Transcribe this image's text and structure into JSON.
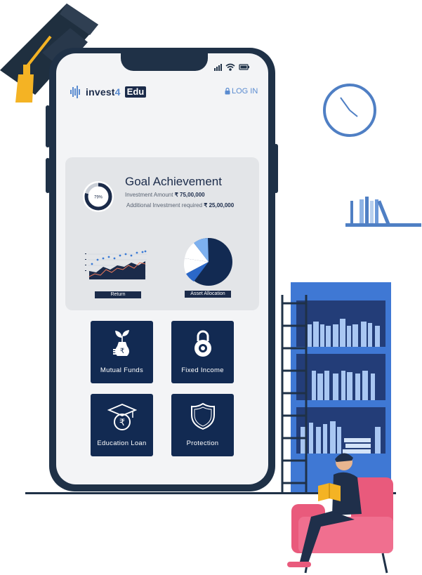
{
  "brand": {
    "name": "invest",
    "accent": "4",
    "badge": "Edu"
  },
  "header": {
    "login_label": "LOG IN"
  },
  "goal": {
    "title": "Goal Achievement",
    "progress_label": "79%",
    "progress": 0.79,
    "investment_label": "Investment Amount",
    "investment_value": "₹ 75,00,000",
    "additional_label": "Additional Investment required",
    "additional_value": "₹ 25,00,000"
  },
  "charts": {
    "return_label": "Return",
    "allocation_label": "Asset Allocation"
  },
  "tiles": [
    {
      "label": "Mutual Funds",
      "icon": "plant-money-icon"
    },
    {
      "label": "Fixed Income",
      "icon": "lock-icon"
    },
    {
      "label": "Education Loan",
      "icon": "graduation-cap-rupee-icon"
    },
    {
      "label": "Protection",
      "icon": "shield-icon"
    }
  ],
  "colors": {
    "navy": "#122a52",
    "frame": "#1f3147",
    "accent": "#5a8bd0",
    "card": "#e3e5e8",
    "shelf_blue": "#3f78d4",
    "chair_pink": "#e95a7c"
  }
}
